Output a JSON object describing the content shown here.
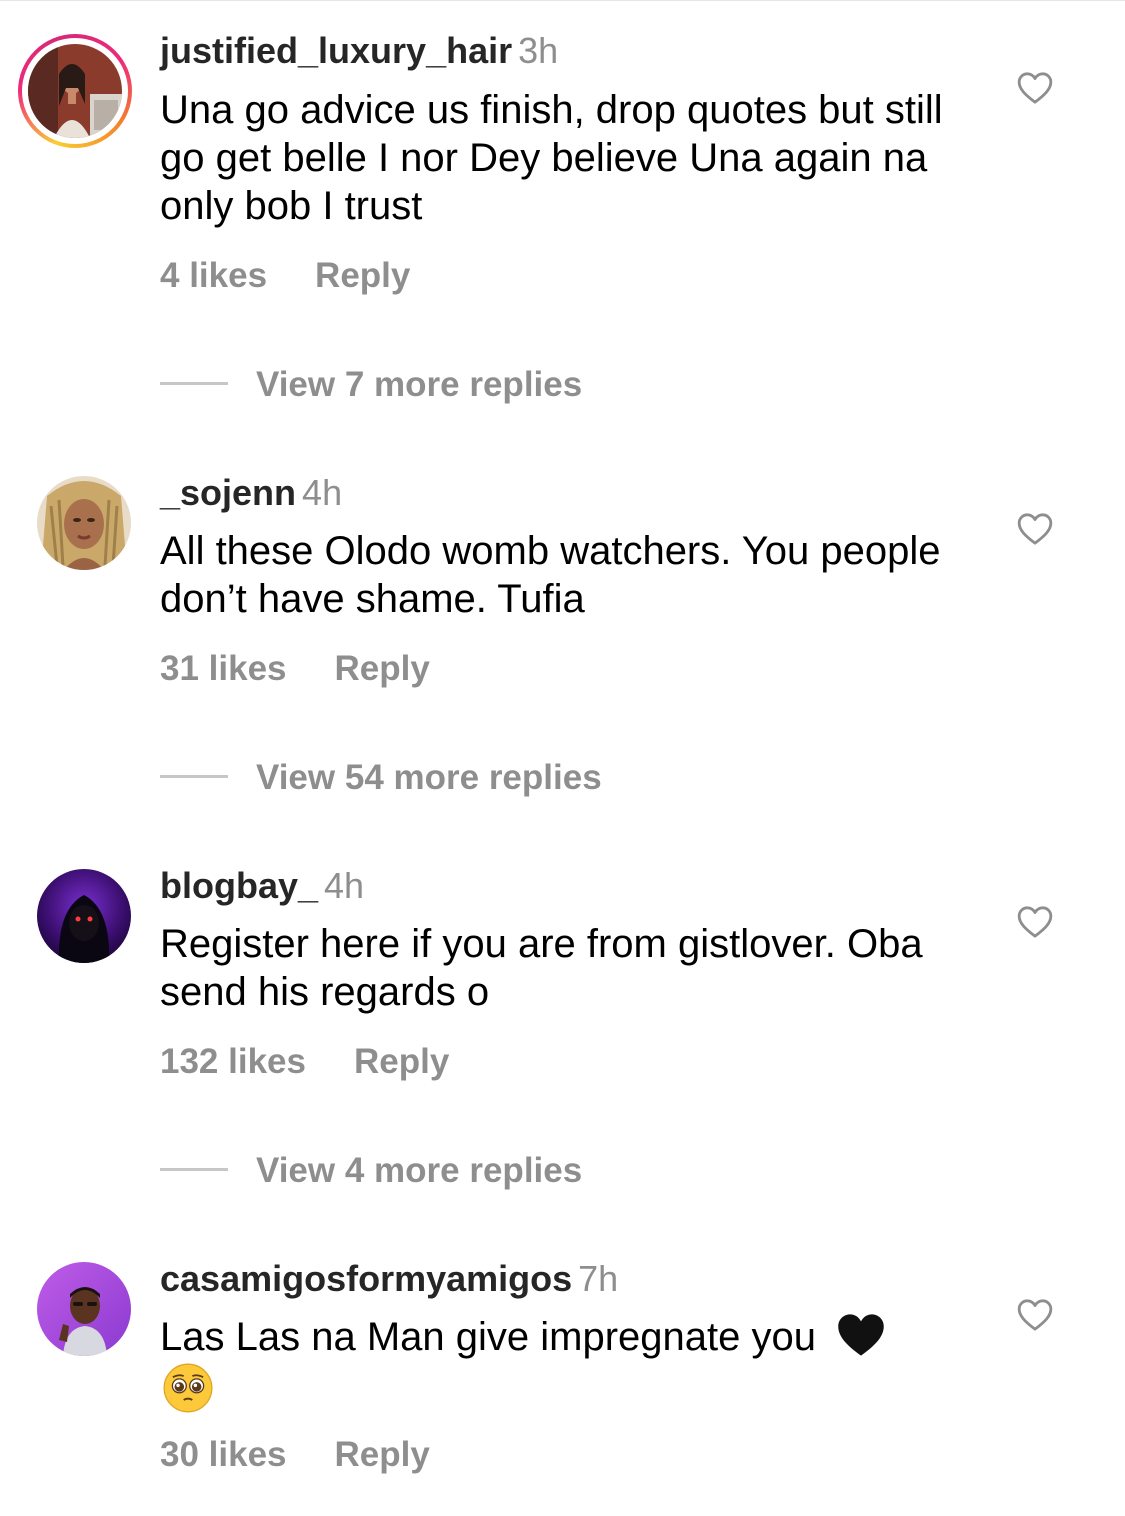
{
  "comments": [
    {
      "username": "justified_luxury_hair",
      "time": "3h",
      "text": "Una go advice us finish, drop quotes but still go get belle I nor Dey believe Una again na only bob I trust",
      "likes": "4 likes",
      "reply_label": "Reply",
      "view_more": "View 7 more replies",
      "has_story_ring": true
    },
    {
      "username": "_sojenn",
      "time": "4h",
      "text": "All these Olodo womb watchers. You people don’t have shame. Tufia",
      "likes": "31 likes",
      "reply_label": "Reply",
      "view_more": "View 54 more replies"
    },
    {
      "username": "blogbay_",
      "time": "4h",
      "text": "Register here if you are from gistlover. Oba send his regards o",
      "likes": "132 likes",
      "reply_label": "Reply",
      "view_more": "View 4 more replies"
    },
    {
      "username": "casamigosformyamigos",
      "time": "7h",
      "text": "Las Las na Man give impregnate you",
      "emojis": [
        "black-heart-emoji",
        "pleading-face-emoji"
      ],
      "likes": "30 likes",
      "reply_label": "Reply"
    }
  ],
  "colors": {
    "secondary_text": "#8e8e8e",
    "username": "#262626",
    "story_ring_start": "#f9ce34",
    "story_ring_end": "#ee2a7b"
  }
}
